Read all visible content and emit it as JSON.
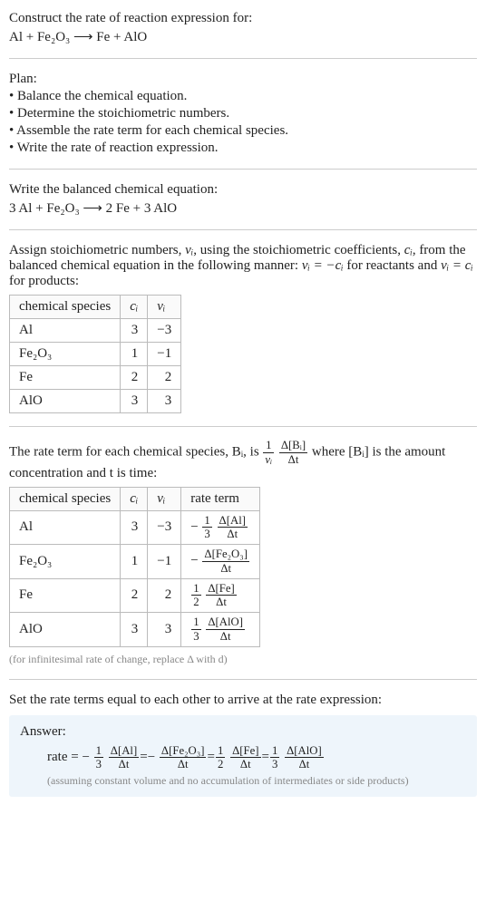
{
  "intro": {
    "title": "Construct the rate of reaction expression for:",
    "equation_display": "Al + Fe₂O₃ ⟶ Fe + AlO"
  },
  "plan": {
    "heading": "Plan:",
    "items": [
      "• Balance the chemical equation.",
      "• Determine the stoichiometric numbers.",
      "• Assemble the rate term for each chemical species.",
      "• Write the rate of reaction expression."
    ]
  },
  "balanced": {
    "heading": "Write the balanced chemical equation:",
    "equation_display": "3 Al + Fe₂O₃ ⟶ 2 Fe + 3 AlO"
  },
  "stoich": {
    "description_prefix": "Assign stoichiometric numbers, ",
    "nu": "νᵢ",
    "description_mid1": ", using the stoichiometric coefficients, ",
    "ci": "cᵢ",
    "description_mid2": ", from the balanced chemical equation in the following manner: ",
    "rule_reactants": "νᵢ = −cᵢ",
    "for_reactants": " for reactants and ",
    "rule_products": "νᵢ = cᵢ",
    "for_products": " for products:",
    "headers": [
      "chemical species",
      "cᵢ",
      "νᵢ"
    ],
    "rows": [
      {
        "species": "Al",
        "c": "3",
        "nu": "−3"
      },
      {
        "species": "Fe₂O₃",
        "c": "1",
        "nu": "−1"
      },
      {
        "species": "Fe",
        "c": "2",
        "nu": "2"
      },
      {
        "species": "AlO",
        "c": "3",
        "nu": "3"
      }
    ]
  },
  "rate_terms": {
    "description_prefix": "The rate term for each chemical species, Bᵢ, is ",
    "frac1_num": "1",
    "frac1_den": "νᵢ",
    "frac2_num": "Δ[Bᵢ]",
    "frac2_den": "Δt",
    "description_suffix": " where [Bᵢ] is the amount concentration and t is time:",
    "headers": [
      "chemical species",
      "cᵢ",
      "νᵢ",
      "rate term"
    ],
    "rows": [
      {
        "species": "Al",
        "c": "3",
        "nu": "−3",
        "sign": "−",
        "coef_num": "1",
        "coef_den": "3",
        "d_num": "Δ[Al]",
        "d_den": "Δt"
      },
      {
        "species": "Fe₂O₃",
        "c": "1",
        "nu": "−1",
        "sign": "−",
        "coef_num": "",
        "coef_den": "",
        "d_num": "Δ[Fe₂O₃]",
        "d_den": "Δt"
      },
      {
        "species": "Fe",
        "c": "2",
        "nu": "2",
        "sign": "",
        "coef_num": "1",
        "coef_den": "2",
        "d_num": "Δ[Fe]",
        "d_den": "Δt"
      },
      {
        "species": "AlO",
        "c": "3",
        "nu": "3",
        "sign": "",
        "coef_num": "1",
        "coef_den": "3",
        "d_num": "Δ[AlO]",
        "d_den": "Δt"
      }
    ],
    "footnote": "(for infinitesimal rate of change, replace Δ with d)"
  },
  "final": {
    "heading": "Set the rate terms equal to each other to arrive at the rate expression:",
    "answer_label": "Answer:",
    "rate_label": "rate = ",
    "eq": " = ",
    "terms": [
      {
        "sign": "−",
        "coef_num": "1",
        "coef_den": "3",
        "d_num": "Δ[Al]",
        "d_den": "Δt"
      },
      {
        "sign": "−",
        "coef_num": "",
        "coef_den": "",
        "d_num": "Δ[Fe₂O₃]",
        "d_den": "Δt"
      },
      {
        "sign": "",
        "coef_num": "1",
        "coef_den": "2",
        "d_num": "Δ[Fe]",
        "d_den": "Δt"
      },
      {
        "sign": "",
        "coef_num": "1",
        "coef_den": "3",
        "d_num": "Δ[AlO]",
        "d_den": "Δt"
      }
    ],
    "note": "(assuming constant volume and no accumulation of intermediates or side products)"
  },
  "chart_data": {
    "type": "table",
    "tables": [
      {
        "title": "stoichiometric numbers",
        "columns": [
          "chemical species",
          "c_i",
          "nu_i"
        ],
        "rows": [
          [
            "Al",
            3,
            -3
          ],
          [
            "Fe2O3",
            1,
            -1
          ],
          [
            "Fe",
            2,
            2
          ],
          [
            "AlO",
            3,
            3
          ]
        ]
      },
      {
        "title": "rate terms",
        "columns": [
          "chemical species",
          "c_i",
          "nu_i",
          "rate term"
        ],
        "rows": [
          [
            "Al",
            3,
            -3,
            "-(1/3) d[Al]/dt"
          ],
          [
            "Fe2O3",
            1,
            -1,
            "- d[Fe2O3]/dt"
          ],
          [
            "Fe",
            2,
            2,
            "(1/2) d[Fe]/dt"
          ],
          [
            "AlO",
            3,
            3,
            "(1/3) d[AlO]/dt"
          ]
        ]
      }
    ]
  }
}
